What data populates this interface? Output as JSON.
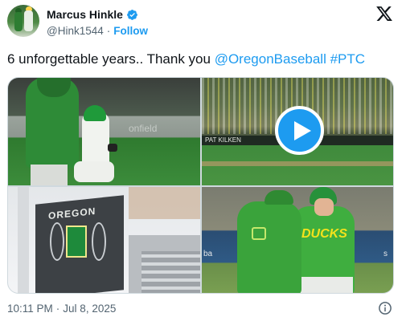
{
  "user": {
    "name": "Marcus Hinkle",
    "handle": "@Hink1544",
    "separator": "·",
    "follow_label": "Follow",
    "verified": true
  },
  "tweet": {
    "text_prefix": "6 unforgettable years.. Thank you ",
    "mention": "@OregonBaseball",
    "space": " ",
    "hashtag": "#PTC"
  },
  "media": {
    "photo1_wall": "onfield",
    "photo2_wall": "PAT KILKEN",
    "photo3_sign": "OREGON",
    "photo4_left": "ba",
    "photo4_right": "s",
    "photo4_jersey": "DUCKS"
  },
  "meta": {
    "time": "10:11 PM",
    "separator": "·",
    "date": "Jul 8, 2025"
  },
  "colors": {
    "link": "#1d9bf0",
    "muted": "#536471",
    "text": "#0f1419"
  },
  "icons": [
    "verified-badge-icon",
    "x-logo-icon",
    "play-icon",
    "info-icon"
  ]
}
